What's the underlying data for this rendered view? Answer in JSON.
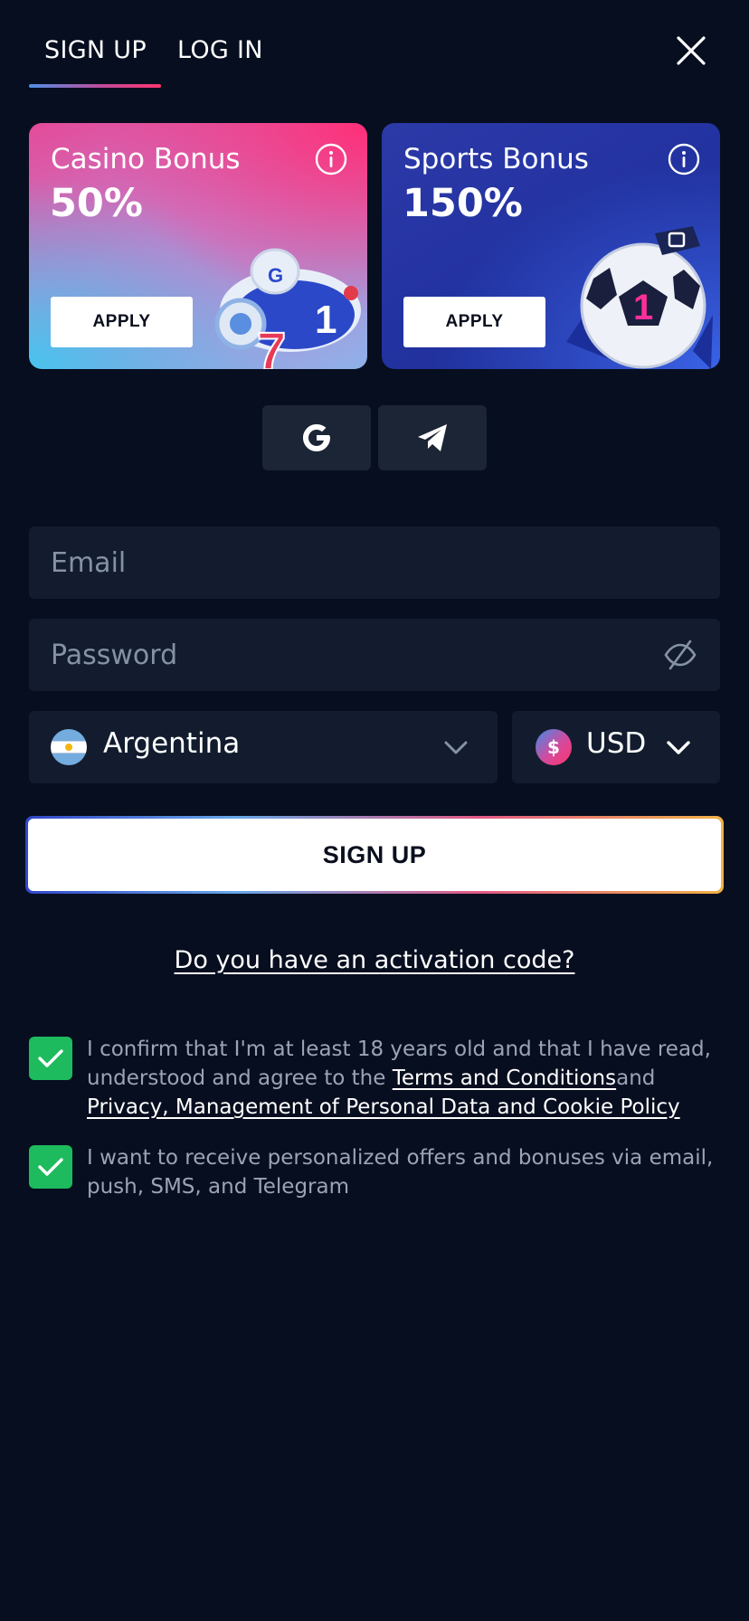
{
  "tabs": {
    "signup": "SIGN UP",
    "login": "LOG IN"
  },
  "bonuses": {
    "casino": {
      "title": "Casino Bonus",
      "percent": "50%",
      "apply": "APPLY"
    },
    "sports": {
      "title": "Sports Bonus",
      "percent": "150%",
      "apply": "APPLY"
    }
  },
  "form": {
    "email_placeholder": "Email",
    "password_placeholder": "Password",
    "country": "Argentina",
    "currency": "USD",
    "currency_symbol": "$",
    "submit": "SIGN UP"
  },
  "activation_link": "Do you have an activation code?",
  "consent": {
    "age_text_before": "I confirm that I'm at least 18 years old and that I have read, understood and agree to the ",
    "terms_link": "Terms and Conditions",
    "and_text": "and",
    "privacy_link": "Privacy, Management of Personal Data and Cookie Policy",
    "marketing_text": "I want to receive personalized offers and bonuses via email, push, SMS, and Telegram",
    "age_checked": true,
    "marketing_checked": true
  },
  "colors": {
    "background": "#070e1f",
    "field": "#121c2e",
    "checkbox": "#1dbb5d",
    "accent_pink": "#ff3572"
  },
  "icons": {
    "close": "close-icon",
    "info": "info-icon",
    "google": "google-icon",
    "telegram": "telegram-icon",
    "eye_off": "eye-off-icon",
    "chevron": "chevron-down-icon",
    "check": "check-icon"
  }
}
